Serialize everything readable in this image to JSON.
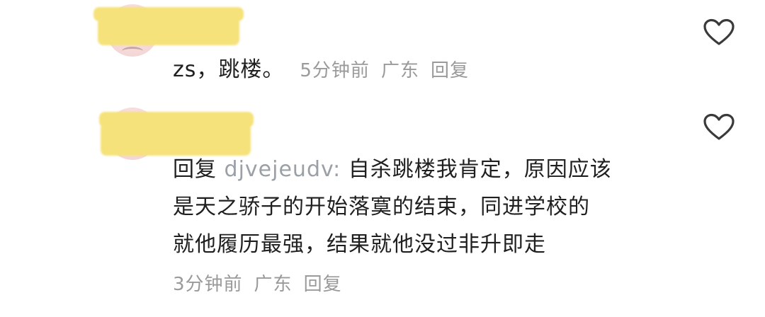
{
  "comments": [
    {
      "text": "zs，跳楼。",
      "meta": {
        "time": "5分钟前",
        "location": "广东",
        "reply_label": "回复"
      },
      "like_icon": "heart-outline-icon"
    },
    {
      "reply_prefix": "回复",
      "reply_to": "djvejeudv:",
      "lines": [
        "自杀跳楼我肯定，原因应该",
        "是天之骄子的开始落寞的结束，同进学校的",
        "就他履历最强，结果就他没过非升即走"
      ],
      "meta": {
        "time": "3分钟前",
        "location": "广东",
        "reply_label": "回复"
      },
      "like_icon": "heart-outline-icon"
    }
  ],
  "colors": {
    "text": "#1f1f1f",
    "meta": "#9a9a9a",
    "redaction": "#f6e27a",
    "icon": "#3a3a3a"
  }
}
